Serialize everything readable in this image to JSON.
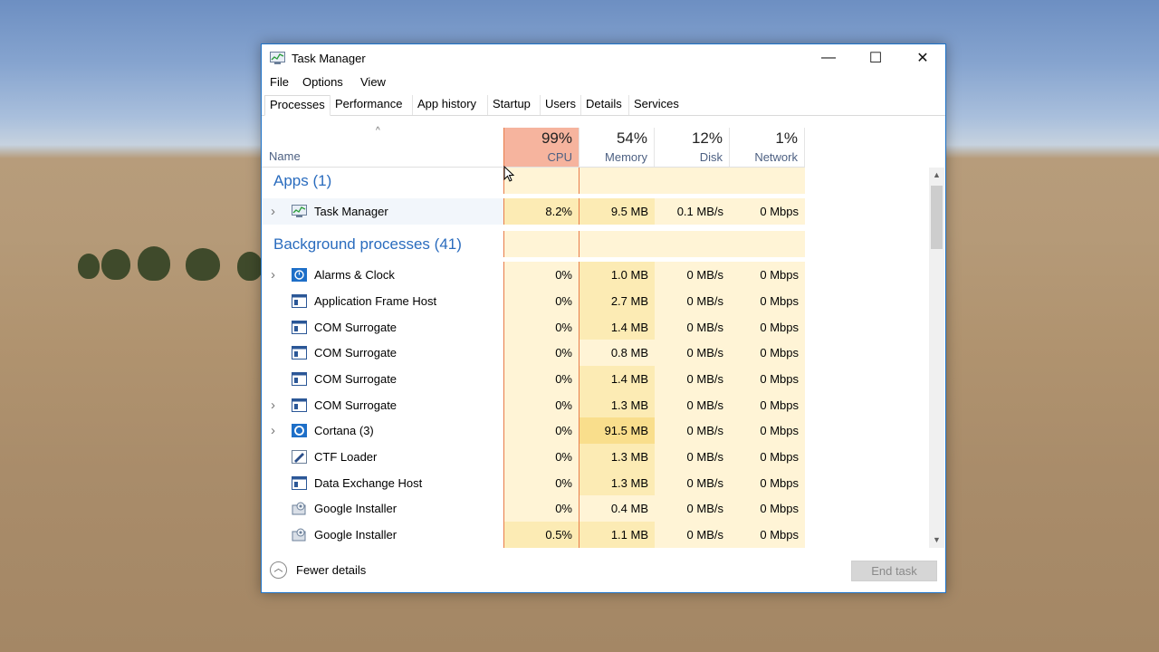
{
  "window": {
    "title": "Task Manager"
  },
  "window_controls": {
    "minimize": "—",
    "maximize": "☐",
    "close": "✕"
  },
  "menu": [
    "File",
    "Options",
    "View"
  ],
  "tabs": [
    "Processes",
    "Performance",
    "App history",
    "Startup",
    "Users",
    "Details",
    "Services"
  ],
  "active_tab": "Processes",
  "header": {
    "name": "Name",
    "columns": [
      {
        "pct": "99%",
        "label": "CPU"
      },
      {
        "pct": "54%",
        "label": "Memory"
      },
      {
        "pct": "12%",
        "label": "Disk"
      },
      {
        "pct": "1%",
        "label": "Network"
      }
    ]
  },
  "groups": [
    {
      "label": "Apps (1)",
      "rows": [
        {
          "name": "Task Manager",
          "icon": "task-manager-icon",
          "expandable": true,
          "cpu": "8.2%",
          "memory": "9.5 MB",
          "disk": "0.1 MB/s",
          "network": "0 Mbps"
        }
      ]
    },
    {
      "label": "Background processes (41)",
      "rows": [
        {
          "name": "Alarms & Clock",
          "icon": "alarms-icon",
          "expandable": true,
          "cpu": "0%",
          "memory": "1.0 MB",
          "disk": "0 MB/s",
          "network": "0 Mbps"
        },
        {
          "name": "Application Frame Host",
          "icon": "process-icon",
          "expandable": false,
          "cpu": "0%",
          "memory": "2.7 MB",
          "disk": "0 MB/s",
          "network": "0 Mbps"
        },
        {
          "name": "COM Surrogate",
          "icon": "process-icon",
          "expandable": false,
          "cpu": "0%",
          "memory": "1.4 MB",
          "disk": "0 MB/s",
          "network": "0 Mbps"
        },
        {
          "name": "COM Surrogate",
          "icon": "process-icon",
          "expandable": false,
          "cpu": "0%",
          "memory": "0.8 MB",
          "disk": "0 MB/s",
          "network": "0 Mbps"
        },
        {
          "name": "COM Surrogate",
          "icon": "process-icon",
          "expandable": false,
          "cpu": "0%",
          "memory": "1.4 MB",
          "disk": "0 MB/s",
          "network": "0 Mbps"
        },
        {
          "name": "COM Surrogate",
          "icon": "process-icon",
          "expandable": true,
          "cpu": "0%",
          "memory": "1.3 MB",
          "disk": "0 MB/s",
          "network": "0 Mbps"
        },
        {
          "name": "Cortana (3)",
          "icon": "cortana-icon",
          "expandable": true,
          "cpu": "0%",
          "memory": "91.5 MB",
          "disk": "0 MB/s",
          "network": "0 Mbps"
        },
        {
          "name": "CTF Loader",
          "icon": "ctf-icon",
          "expandable": false,
          "cpu": "0%",
          "memory": "1.3 MB",
          "disk": "0 MB/s",
          "network": "0 Mbps"
        },
        {
          "name": "Data Exchange Host",
          "icon": "process-icon",
          "expandable": false,
          "cpu": "0%",
          "memory": "1.3 MB",
          "disk": "0 MB/s",
          "network": "0 Mbps"
        },
        {
          "name": "Google Installer",
          "icon": "installer-icon",
          "expandable": false,
          "cpu": "0%",
          "memory": "0.4 MB",
          "disk": "0 MB/s",
          "network": "0 Mbps"
        },
        {
          "name": "Google Installer",
          "icon": "installer-icon",
          "expandable": false,
          "cpu": "0.5%",
          "memory": "1.1 MB",
          "disk": "0 MB/s",
          "network": "0 Mbps"
        }
      ]
    }
  ],
  "footer": {
    "fewer_details": "Fewer details",
    "end_task": "End task"
  },
  "colors": {
    "cpu_header": "#f6b49e",
    "cpu_border": "#e87c4a",
    "group_label": "#2a6cbe",
    "heat_light": "#fff4d6",
    "heat_mid": "#fcebb4",
    "heat_high": "#f9de8c",
    "window_border": "#1e73c8"
  }
}
